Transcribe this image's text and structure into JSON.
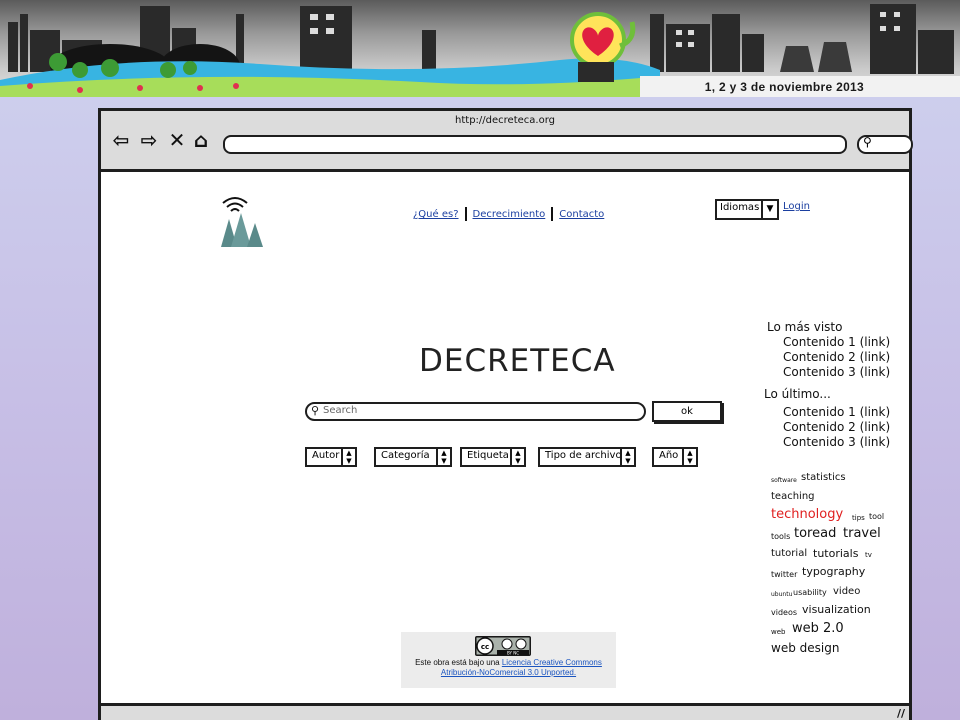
{
  "banner": {
    "event_date": "1, 2 y 3 de noviembre 2013",
    "colors": {
      "sky_dark": "#5b5b5b",
      "grass": "#39b6e0",
      "tree": "#3d9b35",
      "heart": "#e02040"
    }
  },
  "browser": {
    "url": "http://decreteca.org",
    "nav_icons": [
      "back-arrow-icon",
      "forward-arrow-icon",
      "close-x-icon",
      "home-icon"
    ],
    "search_icon": "magnifier-icon"
  },
  "header": {
    "nav": [
      {
        "label": "¿Qué es?"
      },
      {
        "label": "Decrecimiento"
      },
      {
        "label": "Contacto"
      }
    ],
    "language_select": "Idiomas",
    "login": "Login"
  },
  "main": {
    "title": "DECRETECA",
    "search_placeholder": "Search",
    "ok_label": "ok",
    "filters": [
      "Autor",
      "Categoría",
      "Etiqueta",
      "Tipo de archivo",
      "Año"
    ]
  },
  "sidebar": {
    "most_viewed_title": "Lo más visto",
    "most_viewed": [
      "Contenido 1 (link)",
      "Contenido 2 (link)",
      "Contenido 3 (link)"
    ],
    "latest_title": "Lo último...",
    "latest": [
      "Contenido 1 (link)",
      "Contenido 2 (link)",
      "Contenido 3 (link)"
    ]
  },
  "tag_cloud": [
    {
      "text": "software",
      "weight": 1
    },
    {
      "text": "statistics",
      "weight": 3
    },
    {
      "text": "teaching",
      "weight": 3
    },
    {
      "text": "technology",
      "weight": 5,
      "color": "#e02020"
    },
    {
      "text": "tips",
      "weight": 1
    },
    {
      "text": "tool",
      "weight": 2
    },
    {
      "text": "tools",
      "weight": 2
    },
    {
      "text": "toread",
      "weight": 5
    },
    {
      "text": "travel",
      "weight": 5
    },
    {
      "text": "tutorial",
      "weight": 3
    },
    {
      "text": "tutorials",
      "weight": 4
    },
    {
      "text": "tv",
      "weight": 1
    },
    {
      "text": "twitter",
      "weight": 2
    },
    {
      "text": "typography",
      "weight": 4
    },
    {
      "text": "ubuntu",
      "weight": 1
    },
    {
      "text": "usability",
      "weight": 2
    },
    {
      "text": "video",
      "weight": 3
    },
    {
      "text": "videos",
      "weight": 2
    },
    {
      "text": "visualization",
      "weight": 4
    },
    {
      "text": "web",
      "weight": 2
    },
    {
      "text": "web 2.0",
      "weight": 5
    },
    {
      "text": "web design",
      "weight": 5
    }
  ],
  "license": {
    "text": "Este obra está bajo una",
    "link1": "Licencia Creative Commons",
    "link2": "Atribución-NoComercial 3.0 Unported.",
    "badge_label": "BY NC"
  }
}
